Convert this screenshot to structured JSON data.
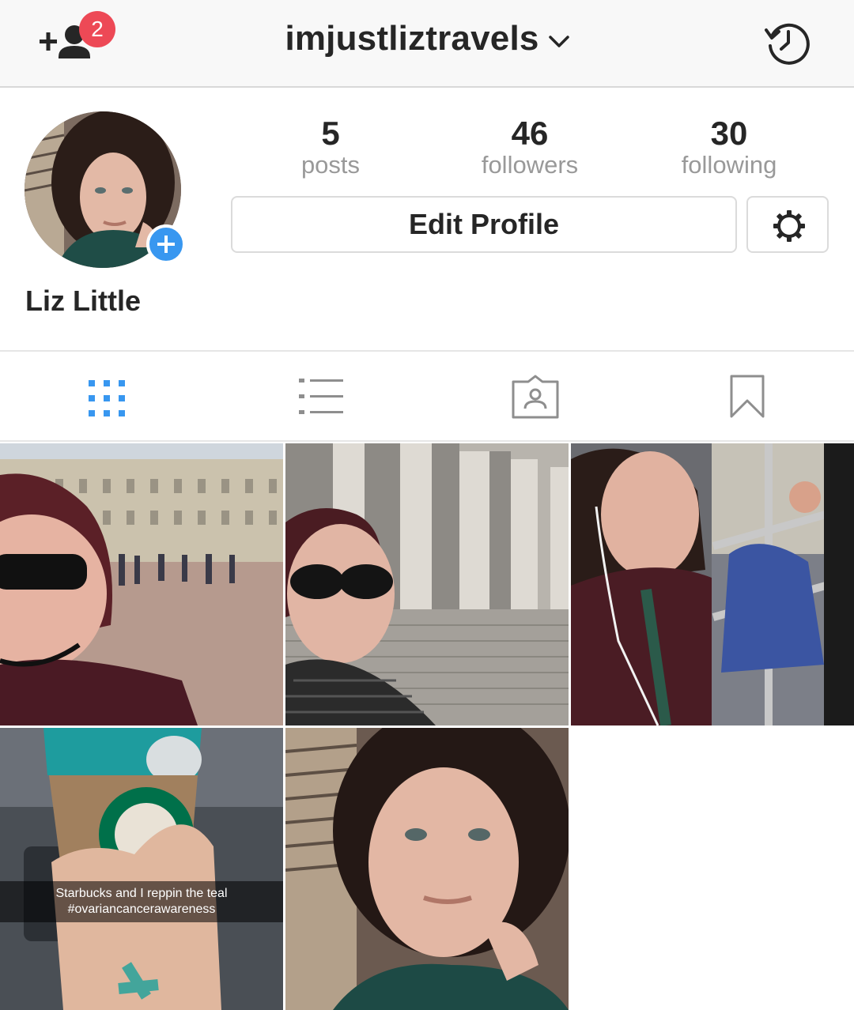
{
  "header": {
    "username": "imjustliztravels",
    "notification_count": "2",
    "icons": {
      "left": "add-people-icon",
      "dropdown": "chevron-down-icon",
      "right": "history-icon"
    }
  },
  "profile": {
    "full_name": "Liz Little",
    "stats": [
      {
        "value": "5",
        "label": "posts"
      },
      {
        "value": "46",
        "label": "followers"
      },
      {
        "value": "30",
        "label": "following"
      }
    ],
    "edit_button_label": "Edit Profile",
    "settings_icon": "gear-icon",
    "avatar_add_icon": "plus-icon"
  },
  "tabs": [
    {
      "name": "grid",
      "icon": "grid-icon",
      "active": true
    },
    {
      "name": "list",
      "icon": "list-icon",
      "active": false
    },
    {
      "name": "tagged",
      "icon": "tagged-photos-icon",
      "active": false
    },
    {
      "name": "saved",
      "icon": "bookmark-icon",
      "active": false
    }
  ],
  "posts": [
    {
      "caption": ""
    },
    {
      "caption": ""
    },
    {
      "caption": ""
    },
    {
      "caption": "Starbucks and I reppin the teal\n#ovariancancerawareness"
    },
    {
      "caption": ""
    }
  ],
  "colors": {
    "accent_blue": "#3897f0",
    "badge_red": "#ed4956",
    "text_dark": "#262626",
    "text_muted": "#999999",
    "border": "#dbdbdb"
  }
}
